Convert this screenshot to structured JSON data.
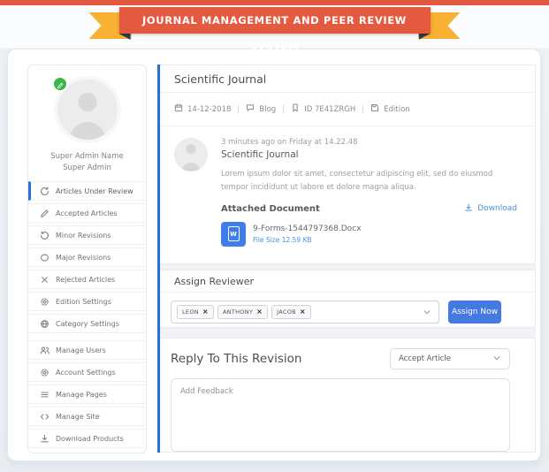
{
  "banner": {
    "title": "JOURNAL MANAGEMENT AND PEER REVIEW SYSTEM"
  },
  "colors": {
    "ribbon_red": "#e4593f",
    "ribbon_yellow": "#f8b133",
    "ribbon_fold": "#2e3d52",
    "accent_blue": "#2a6ddf",
    "button_blue": "#4479e1",
    "link_blue": "#4a90e2",
    "file_icon_blue": "#3f7ee8",
    "badge_green": "#3cb54a"
  },
  "sidebar": {
    "profile": {
      "name": "Super Admin Name",
      "role": "Super Admin",
      "edit_icon": "pencil-icon"
    },
    "items": [
      {
        "label": "Articles Under Review",
        "icon": "rotate-cw-icon",
        "active": true
      },
      {
        "label": "Accepted Articles",
        "icon": "edit-icon",
        "active": false
      },
      {
        "label": "Minor Revisions",
        "icon": "rotate-ccw-icon",
        "active": false
      },
      {
        "label": "Major Revisions",
        "icon": "refresh-icon",
        "active": false
      },
      {
        "label": "Rejected Articles",
        "icon": "x-icon",
        "active": false
      },
      {
        "label": "Edition Settings",
        "icon": "gear-icon",
        "active": false
      },
      {
        "label": "Category Settings",
        "icon": "globe-icon",
        "active": false
      },
      {
        "label": "Manage Users",
        "icon": "users-icon",
        "active": false
      },
      {
        "label": "Account Settings",
        "icon": "gear-icon",
        "active": false
      },
      {
        "label": "Manage Pages",
        "icon": "list-icon",
        "active": false
      },
      {
        "label": "Manage Site",
        "icon": "code-icon",
        "active": false
      },
      {
        "label": "Download Products",
        "icon": "download-icon",
        "active": false
      }
    ]
  },
  "main": {
    "title": "Scientific Journal",
    "meta": {
      "date": "14-12-2018",
      "type": "Blog",
      "id": "ID 7E41ZRGH",
      "edition": "Edition",
      "icons": [
        "calendar-icon",
        "chat-icon",
        "bookmark-icon",
        "save-icon"
      ]
    },
    "post": {
      "timestamp": "3 minutes ago on Friday at 14.22.48",
      "title": "Scientific Journal",
      "body": "Lorem ipsum dolor sit amet, consectetur adipiscing elit, sed do eiusmod tempor incididunt ut labore et dolore magna aliqua.",
      "attachment": {
        "section_label": "Attached Document",
        "download_label": "Download",
        "file_icon": "word-file-icon",
        "file_glyph": "W",
        "file_name": "9-Forms-1544797368.Docx",
        "file_size": "File Size 12.59 KB"
      }
    },
    "assign": {
      "heading": "Assign Reviewer",
      "tags": [
        "LEON",
        "ANTHONY",
        "JACOB"
      ],
      "tag_remove_glyph": "×",
      "button_label": "Assign Now"
    },
    "reply": {
      "heading": "Reply To This Revision",
      "dropdown_value": "Accept Article",
      "textarea_placeholder": "Add Feedback"
    }
  }
}
